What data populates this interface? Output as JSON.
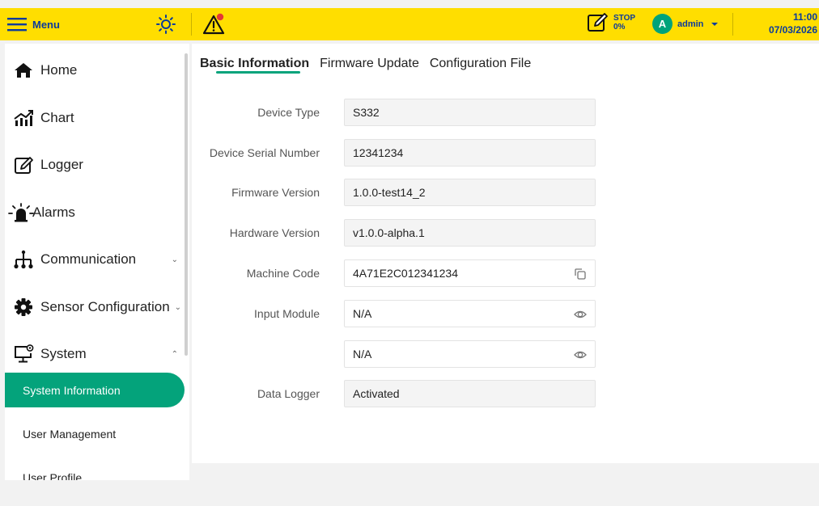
{
  "topbar": {
    "menu_label": "Menu",
    "stop_label": "STOP",
    "stop_percent": "0%",
    "user_initial": "A",
    "user_name": "admin",
    "time": "11:00",
    "date": "07/03/2026",
    "colors": {
      "bar": "#ffde00",
      "text": "#0b3b9b",
      "alert_dot": "#e53935",
      "avatar": "#00a37a"
    }
  },
  "sidebar": {
    "items": [
      {
        "label": "Home",
        "icon": "home-icon"
      },
      {
        "label": "Chart",
        "icon": "chart-icon"
      },
      {
        "label": "Logger",
        "icon": "logger-icon"
      },
      {
        "label": "Alarms",
        "icon": "alarm-siren-icon"
      },
      {
        "label": "Communication",
        "icon": "network-icon",
        "chevron": "⌄"
      },
      {
        "label": "Sensor Configuration",
        "icon": "gear-icon",
        "chevron": "⌄"
      },
      {
        "label": "System",
        "icon": "monitor-gear-icon",
        "chevron": "⌃"
      }
    ],
    "sub_items": [
      {
        "label": "System Information",
        "active": true
      },
      {
        "label": "User Management",
        "active": false
      },
      {
        "label": "User Profile",
        "active": false
      }
    ],
    "colors": {
      "active_bg": "#04a37b"
    }
  },
  "main": {
    "tabs": [
      {
        "label": "Basic Information",
        "active": true
      },
      {
        "label": "Firmware Update",
        "active": false
      },
      {
        "label": "Configuration File",
        "active": false
      }
    ],
    "fields": [
      {
        "label": "Device Type",
        "value": "S332"
      },
      {
        "label": "Device Serial Number",
        "value": "12341234"
      },
      {
        "label": "Firmware Version",
        "value": "1.0.0-test14_2"
      },
      {
        "label": "Hardware Version",
        "value": "v1.0.0-alpha.1"
      },
      {
        "label": "Machine Code",
        "value": "4A71E2C012341234",
        "icon": "copy-icon"
      },
      {
        "label": "Input Module",
        "value": "N/A",
        "icon": "eye-icon"
      },
      {
        "label": "",
        "value": "N/A",
        "icon": "eye-icon"
      },
      {
        "label": "Data Logger",
        "value": "Activated"
      }
    ]
  }
}
